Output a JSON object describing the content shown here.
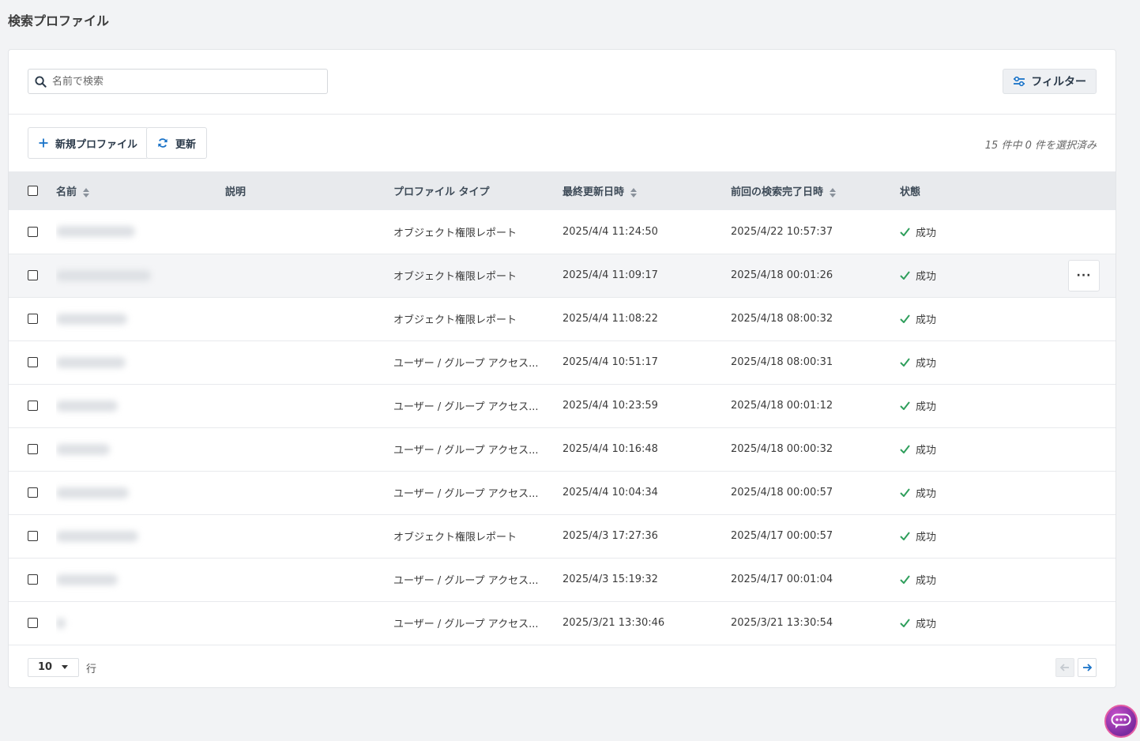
{
  "page": {
    "title": "検索プロファイル"
  },
  "search": {
    "placeholder": "名前で検索"
  },
  "toolbar": {
    "filter_label": "フィルター",
    "new_profile_label": "新規プロファイル",
    "refresh_label": "更新",
    "selection_count": "15 件中 0 件を選択済み"
  },
  "table": {
    "columns": {
      "name": "名前",
      "description": "説明",
      "profile_type": "プロファイル タイプ",
      "last_updated": "最終更新日時",
      "last_search_completed": "前回の検索完了日時",
      "status": "状態"
    },
    "rows": [
      {
        "type": "オブジェクト権限レポート",
        "updated": "2025/4/4 11:24:50",
        "completed": "2025/4/22 10:57:37",
        "status": "成功"
      },
      {
        "type": "オブジェクト権限レポート",
        "updated": "2025/4/4 11:09:17",
        "completed": "2025/4/18 00:01:26",
        "status": "成功"
      },
      {
        "type": "オブジェクト権限レポート",
        "updated": "2025/4/4 11:08:22",
        "completed": "2025/4/18 08:00:32",
        "status": "成功"
      },
      {
        "type": "ユーザー / グループ アクセス...",
        "updated": "2025/4/4 10:51:17",
        "completed": "2025/4/18 08:00:31",
        "status": "成功"
      },
      {
        "type": "ユーザー / グループ アクセス...",
        "updated": "2025/4/4 10:23:59",
        "completed": "2025/4/18 00:01:12",
        "status": "成功"
      },
      {
        "type": "ユーザー / グループ アクセス...",
        "updated": "2025/4/4 10:16:48",
        "completed": "2025/4/18 00:00:32",
        "status": "成功"
      },
      {
        "type": "ユーザー / グループ アクセス...",
        "updated": "2025/4/4 10:04:34",
        "completed": "2025/4/18 00:00:57",
        "status": "成功"
      },
      {
        "type": "オブジェクト権限レポート",
        "updated": "2025/4/3 17:27:36",
        "completed": "2025/4/17 00:00:57",
        "status": "成功"
      },
      {
        "type": "ユーザー / グループ アクセス...",
        "updated": "2025/4/3 15:19:32",
        "completed": "2025/4/17 00:01:04",
        "status": "成功"
      },
      {
        "type": "ユーザー / グループ アクセス...",
        "updated": "2025/3/21 13:30:46",
        "completed": "2025/3/21 13:30:54",
        "status": "成功"
      }
    ],
    "row_menu_label": "···"
  },
  "pagination": {
    "page_size": "10",
    "rows_label": "行"
  },
  "icons": {
    "search": "search-icon",
    "filter": "sliders-icon",
    "add": "plus-icon",
    "refresh": "refresh-icon",
    "status_success": "check-icon",
    "sort": "sort-icon",
    "prev": "arrow-left-icon",
    "next": "arrow-right-icon",
    "chat": "chat-bubble-icon"
  },
  "colors": {
    "accent": "#1a73c8",
    "success": "#2e9e5b",
    "chat": "#8a2fa8"
  }
}
